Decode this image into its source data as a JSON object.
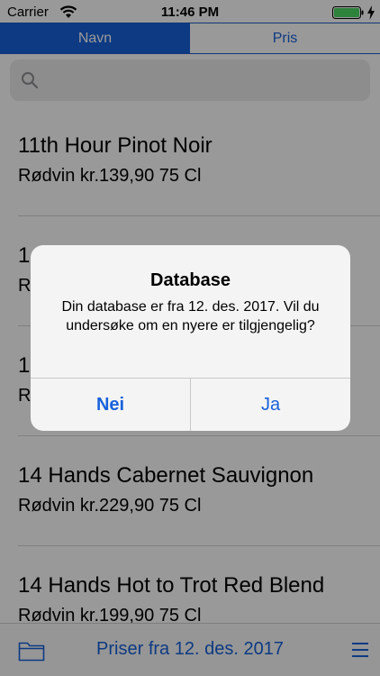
{
  "status_bar": {
    "carrier": "Carrier",
    "time": "11:46 PM"
  },
  "tabs": [
    {
      "label": "Navn",
      "selected": true
    },
    {
      "label": "Pris",
      "selected": false
    }
  ],
  "search": {
    "placeholder": "",
    "value": ""
  },
  "wines": [
    {
      "name": "11th Hour Pinot Noir",
      "detail": "Rødvin kr.139,90 75 Cl"
    },
    {
      "name": "1",
      "detail": "R"
    },
    {
      "name": "1",
      "detail": "R"
    },
    {
      "name": "14 Hands Cabernet Sauvignon",
      "detail": "Rødvin kr.229,90 75 Cl"
    },
    {
      "name": "14 Hands Hot to Trot Red Blend",
      "detail": "Rødvin kr.199,90 75 Cl"
    }
  ],
  "toolbar": {
    "title": "Priser fra 12. des. 2017"
  },
  "alert": {
    "title": "Database",
    "message": "Din database er fra 12. des. 2017. Vil du undersøke om en nyere er tilgjengelig?",
    "cancel_label": "Nei",
    "confirm_label": "Ja"
  },
  "colors": {
    "accent": "#1761db",
    "battery": "#4cd964"
  },
  "icons": [
    "wifi-icon",
    "battery-icon",
    "charging-bolt-icon",
    "search-icon",
    "folder-icon",
    "menu-icon"
  ]
}
